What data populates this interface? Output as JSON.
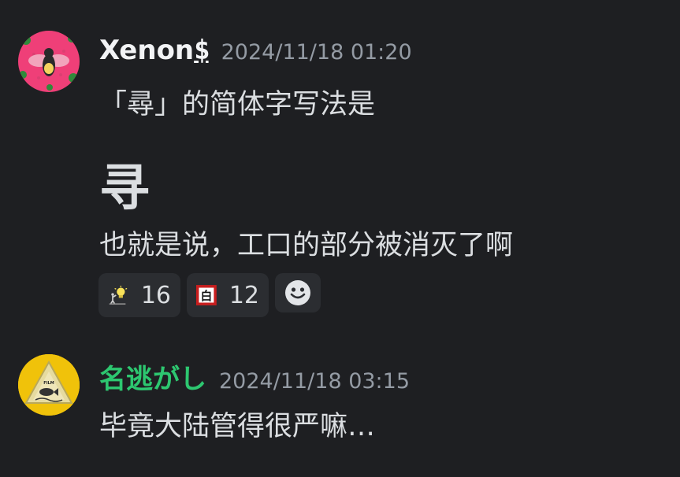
{
  "messages": [
    {
      "username": "Xenon",
      "username_suffix": "$",
      "timestamp": "2024/11/18 01:20",
      "line1": "「尋」的简体字写法是",
      "big_char": "寻",
      "line2": "也就是说，工口的部分被消灭了啊",
      "reactions": [
        {
          "emoji": "lightbulb-person-emoji",
          "count": "16"
        },
        {
          "emoji": "white-character-sign-emoji",
          "count": "12"
        }
      ],
      "add_reaction_icon": "smiley-icon"
    },
    {
      "username": "名逃がし",
      "username_color": "#2dc770",
      "timestamp": "2024/11/18 03:15",
      "line1": "毕竟大陆管得很严嘛…"
    }
  ]
}
